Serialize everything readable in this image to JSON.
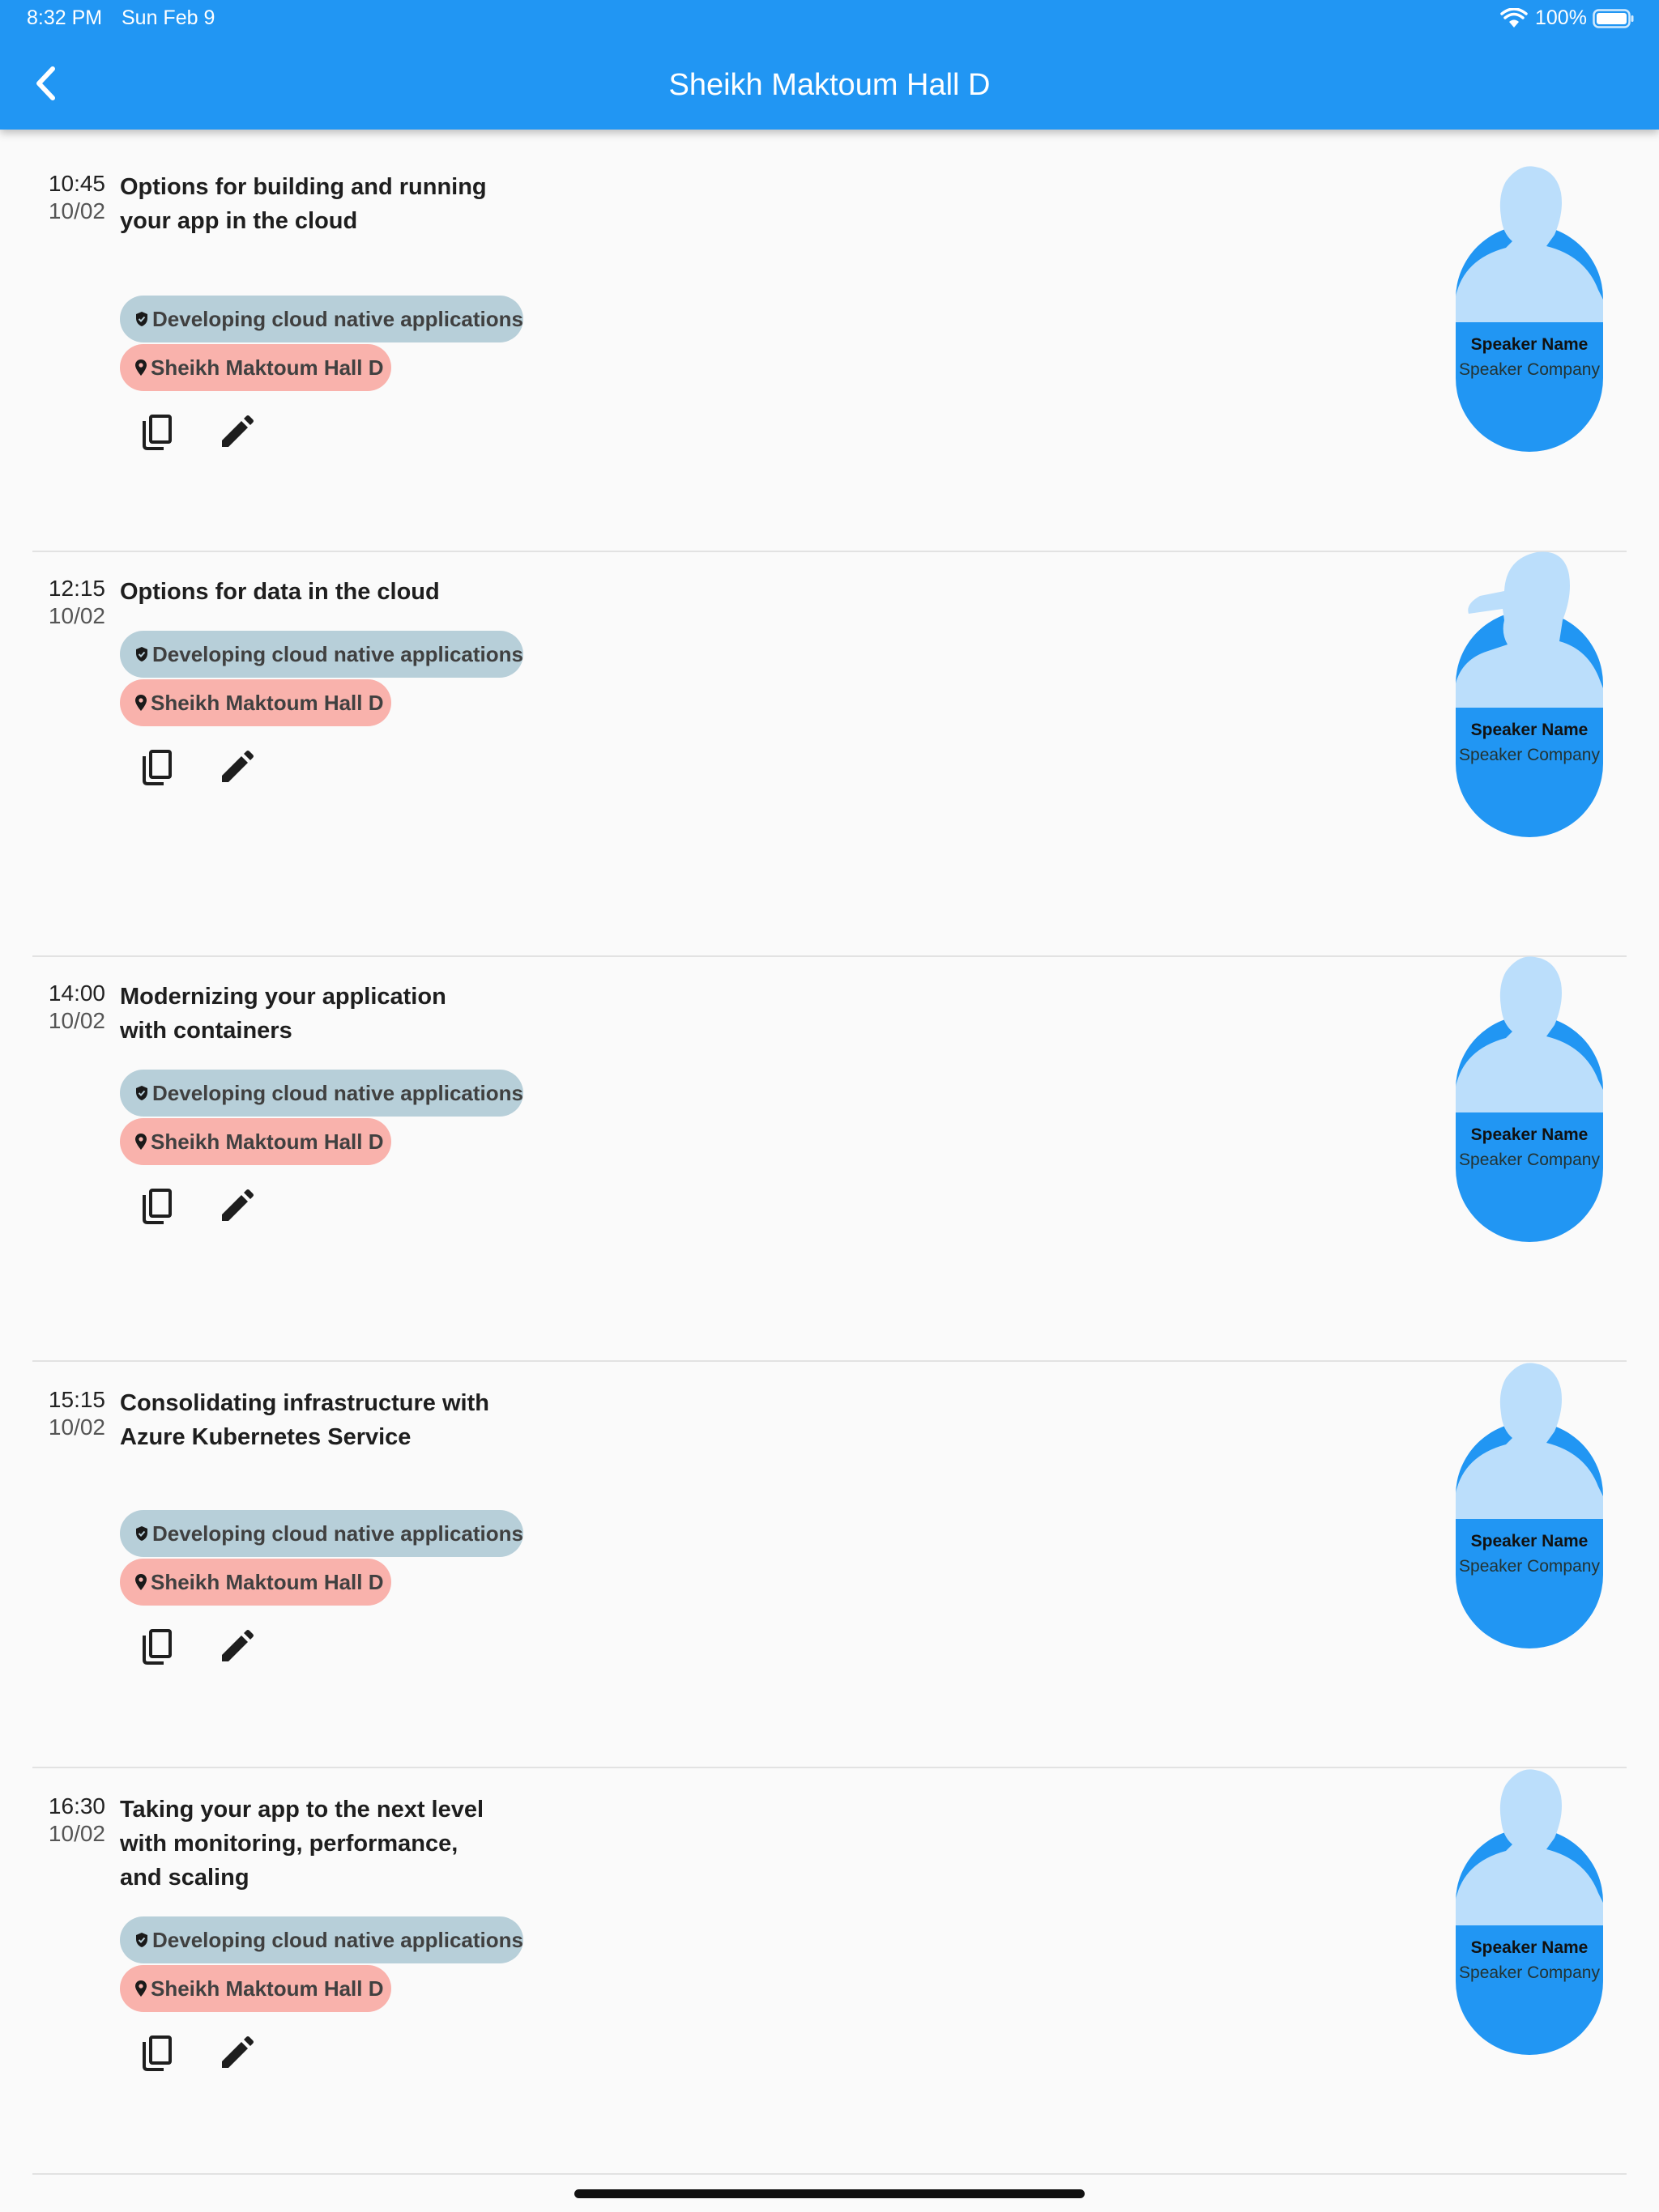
{
  "status_bar": {
    "time": "8:32 PM",
    "date": "Sun Feb 9",
    "battery": "100%"
  },
  "header": {
    "title": "Sheikh Maktoum Hall D"
  },
  "sessions": [
    {
      "time": "10:45",
      "date": "10/02",
      "title": "Options for building and running your app in the cloud",
      "track": "Developing cloud native applications",
      "room": "Sheikh Maktoum Hall D",
      "speaker": {
        "name": "Speaker Name",
        "company": "Speaker Company",
        "silhouette": "person-silhouette"
      }
    },
    {
      "time": "12:15",
      "date": "10/02",
      "title": "Options for data in the cloud",
      "track": "Developing cloud native applications",
      "room": "Sheikh Maktoum Hall D",
      "speaker": {
        "name": "Speaker Name",
        "company": "Speaker Company",
        "silhouette": "person-with-cap-silhouette"
      }
    },
    {
      "time": "14:00",
      "date": "10/02",
      "title": "Modernizing your application with containers",
      "track": "Developing cloud native applications",
      "room": "Sheikh Maktoum Hall D",
      "speaker": {
        "name": "Speaker Name",
        "company": "Speaker Company",
        "silhouette": "person-silhouette"
      }
    },
    {
      "time": "15:15",
      "date": "10/02",
      "title": "Consolidating infrastructure with Azure Kubernetes Service",
      "track": "Developing cloud native applications",
      "room": "Sheikh Maktoum Hall D",
      "speaker": {
        "name": "Speaker Name",
        "company": "Speaker Company",
        "silhouette": "person-silhouette"
      }
    },
    {
      "time": "16:30",
      "date": "10/02",
      "title": "Taking your app to the next level with monitoring, performance, and scaling",
      "track": "Developing cloud native applications",
      "room": "Sheikh Maktoum Hall D",
      "speaker": {
        "name": "Speaker Name",
        "company": "Speaker Company",
        "silhouette": "person-silhouette"
      }
    }
  ],
  "colors": {
    "app_bar": "#2196f3",
    "track_chip": "#b7cfd9",
    "room_chip": "#f9b2ac",
    "speaker_pill": "#2196f3",
    "silhouette": "#bbdefb"
  },
  "icons": {
    "back": "chevron-left-icon",
    "track": "shield-check-icon",
    "room": "map-pin-icon",
    "copy": "copy-icon",
    "edit": "pencil-icon",
    "wifi": "wifi-icon",
    "battery": "battery-icon"
  }
}
